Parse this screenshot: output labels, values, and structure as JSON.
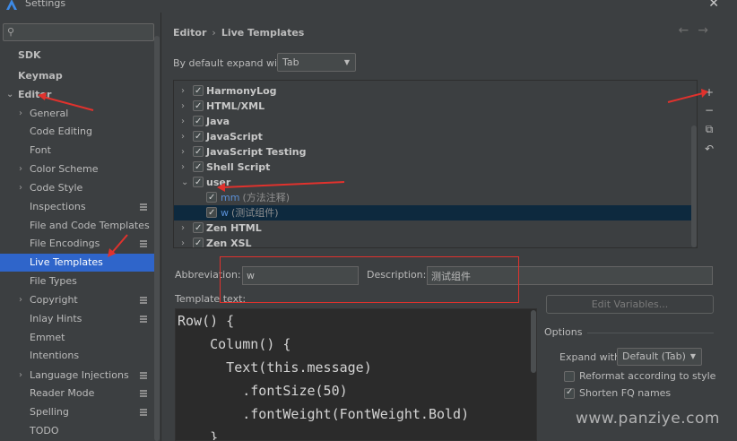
{
  "window": {
    "title": "Settings",
    "close": "✕"
  },
  "search": {
    "placeholder": "",
    "icon": "search-icon"
  },
  "sidebar": {
    "items": [
      {
        "label": "SDK"
      },
      {
        "label": "Keymap"
      },
      {
        "label": "Editor"
      },
      {
        "label": "General"
      },
      {
        "label": "Code Editing"
      },
      {
        "label": "Font"
      },
      {
        "label": "Color Scheme"
      },
      {
        "label": "Code Style"
      },
      {
        "label": "Inspections"
      },
      {
        "label": "File and Code Templates"
      },
      {
        "label": "File Encodings"
      },
      {
        "label": "Live Templates"
      },
      {
        "label": "File Types"
      },
      {
        "label": "Copyright"
      },
      {
        "label": "Inlay Hints"
      },
      {
        "label": "Emmet"
      },
      {
        "label": "Intentions"
      },
      {
        "label": "Language Injections"
      },
      {
        "label": "Reader Mode"
      },
      {
        "label": "Spelling"
      },
      {
        "label": "TODO"
      }
    ]
  },
  "breadcrumb": {
    "parent": "Editor",
    "sep": "›",
    "current": "Live Templates"
  },
  "nav": {
    "back": "←",
    "forward": "→"
  },
  "expand": {
    "label": "By default expand with",
    "value": "Tab"
  },
  "tree": {
    "groups": [
      {
        "label": "HarmonyLog"
      },
      {
        "label": "HTML/XML"
      },
      {
        "label": "Java"
      },
      {
        "label": "JavaScript"
      },
      {
        "label": "JavaScript Testing"
      },
      {
        "label": "Shell Script"
      },
      {
        "label": "user"
      },
      {
        "label": "Zen HTML"
      },
      {
        "label": "Zen XSL"
      }
    ],
    "user_items": [
      {
        "abbr": "mm",
        "desc": "(方法注释)"
      },
      {
        "abbr": "w",
        "desc": "(测试组件)"
      }
    ]
  },
  "tools": {
    "add": "+",
    "remove": "−",
    "copy": "⧉",
    "restore": "↶"
  },
  "fields": {
    "abbreviation_label": "Abbreviation:",
    "abbreviation_value": "w",
    "description_label": "Description:",
    "description_value": "测试组件",
    "template_text_label": "Template text:"
  },
  "code": {
    "lines": [
      "Row() {",
      "    Column() {",
      "      Text(this.message)",
      "        .fontSize(50)",
      "        .fontWeight(FontWeight.Bold)",
      "    }"
    ]
  },
  "options": {
    "edit_variables": "Edit Variables...",
    "title": "Options",
    "expand_with_label": "Expand with",
    "expand_with_value": "Default (Tab)",
    "reformat_label": "Reformat according to style",
    "shorten_label": "Shorten FQ names",
    "reformat_checked": false,
    "shorten_checked": true
  },
  "watermark": "www.panziye.com",
  "colors": {
    "selection": "#2f65ca",
    "annotation": "#e0322d",
    "accent_text": "#5a8fd6"
  }
}
